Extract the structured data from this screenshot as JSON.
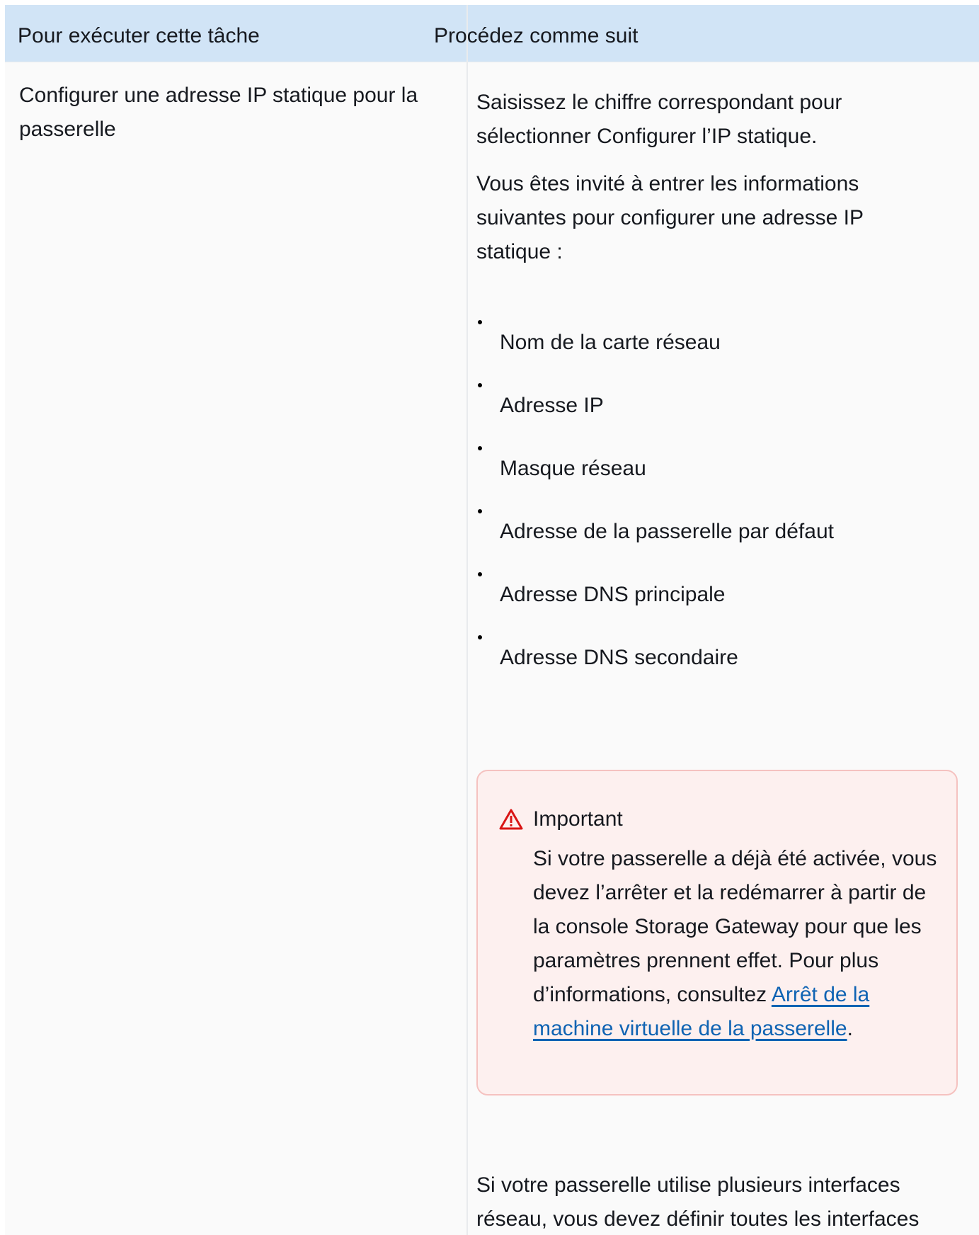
{
  "table": {
    "headers": {
      "task": "Pour exécuter cette tâche",
      "procedure": "Procédez comme suit"
    },
    "row": {
      "task": "Configurer une adresse IP statique pour la passerelle",
      "step1": "Saisissez le chiffre correspondant pour sélectionner Configurer l’IP statique.",
      "step2": "Vous êtes invité à entrer les informations suivantes pour configurer une adresse IP statique :",
      "fields": [
        "Nom de la carte réseau",
        "Adresse IP",
        "Masque réseau",
        "Adresse de la passerelle par défaut",
        "Adresse DNS principale",
        "Adresse DNS secondaire"
      ],
      "alert": {
        "icon": "warning-triangle-icon",
        "icon_color": "#d91515",
        "title": "Important",
        "body": "Si votre passerelle a déjà été activée, vous devez l’arrêter et la redémarrer à partir de la console Storage Gateway pour que les paramètres prennent effet. Pour plus d’informations, consultez ",
        "link_text": "Arrêt de la machine virtuelle de la passerelle",
        "suffix": "."
      },
      "step3": "Si votre passerelle utilise plusieurs interfaces réseau, vous devez définir toutes les interfaces"
    }
  },
  "colors": {
    "header_bg": "#d1e4f6",
    "alert_bg": "#fdf0ef",
    "alert_border": "#f5c2c0",
    "link": "#0f63b3"
  }
}
